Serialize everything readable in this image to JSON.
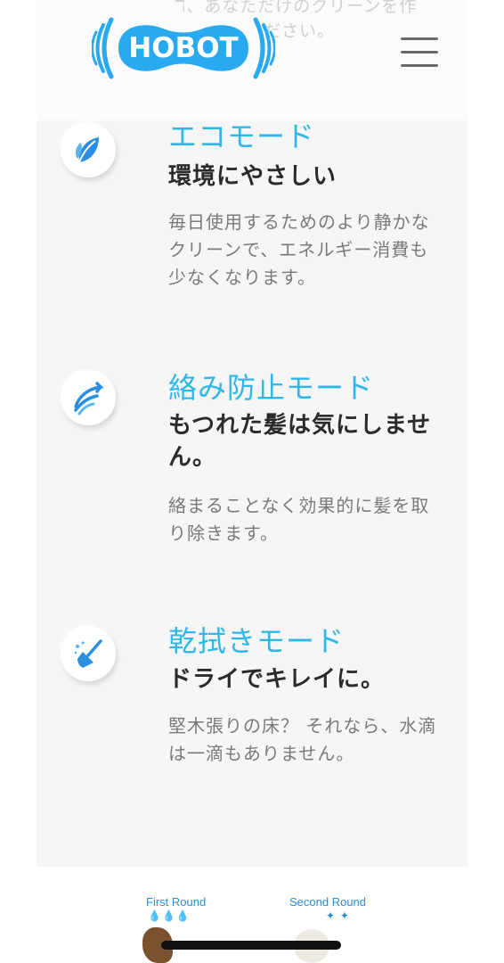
{
  "header": {
    "ghost_line_1": "ℸ、あなただけのクリーンを作",
    "ghost_line_2": "ださい。",
    "logo_text": "HOBOT",
    "menu_icon": "hamburger-menu-icon"
  },
  "features": [
    {
      "icon": "leaf-icon",
      "title": "エコモード",
      "subtitle": "環境にやさしい",
      "description": "毎日使用するためのより静かなクリーンで、エネルギー消費も少なくなります。"
    },
    {
      "icon": "feather-wind-icon",
      "title": "絡み防止モード",
      "subtitle": "もつれた髪は気にしません。",
      "description": "絡まることなく効果的に髪を取り除きます。"
    },
    {
      "icon": "broom-icon",
      "title": "乾拭きモード",
      "subtitle": "ドライでキレイに。",
      "description": "堅木張りの床？ それなら、水滴は一滴もありません。"
    }
  ],
  "compare": {
    "first_label": "First Round",
    "second_label": "Second Round",
    "first_drops": "💧💧💧",
    "second_sparkles": "✦ ✦"
  },
  "colors": {
    "accent": "#2fb7ea",
    "logo_blue": "#29a9f0",
    "panel_bg": "#f6f6f6"
  }
}
